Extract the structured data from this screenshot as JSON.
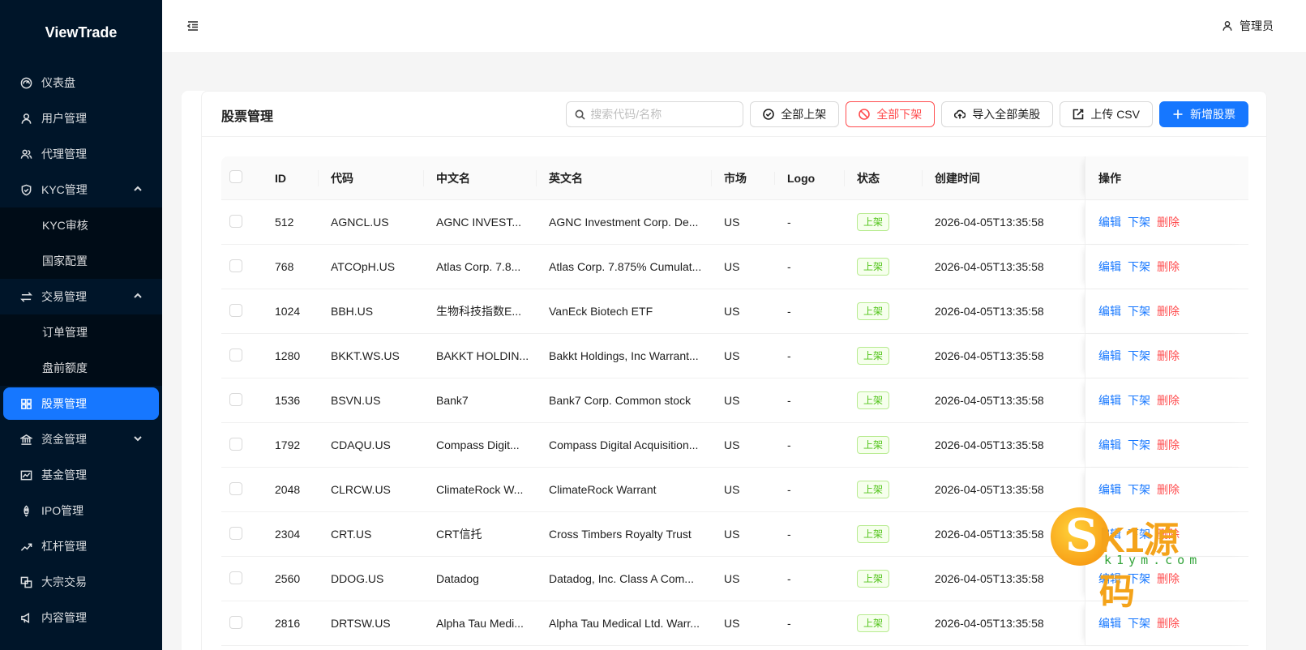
{
  "sidebar": {
    "logo": "ViewTrade",
    "items": [
      {
        "label": "仪表盘",
        "icon": "dashboard-icon"
      },
      {
        "label": "用户管理",
        "icon": "user-icon"
      },
      {
        "label": "代理管理",
        "icon": "team-icon"
      },
      {
        "label": "KYC管理",
        "icon": "shield-icon",
        "expanded": true,
        "children": [
          {
            "label": "KYC审核"
          },
          {
            "label": "国家配置"
          }
        ]
      },
      {
        "label": "交易管理",
        "icon": "swap-icon",
        "expanded": true,
        "children": [
          {
            "label": "订单管理"
          },
          {
            "label": "盘前额度"
          }
        ]
      },
      {
        "label": "股票管理",
        "icon": "grid-icon",
        "active": true
      },
      {
        "label": "资金管理",
        "icon": "bank-icon",
        "expanded": false
      },
      {
        "label": "基金管理",
        "icon": "fund-icon"
      },
      {
        "label": "IPO管理",
        "icon": "rocket-icon"
      },
      {
        "label": "杠杆管理",
        "icon": "rise-icon"
      },
      {
        "label": "大宗交易",
        "icon": "block-icon"
      },
      {
        "label": "内容管理",
        "icon": "sound-icon"
      }
    ]
  },
  "header": {
    "user": "管理员"
  },
  "card": {
    "title": "股票管理",
    "search_placeholder": "搜索代码/名称",
    "buttons": {
      "list_all": "全部上架",
      "delist_all": "全部下架",
      "import_us": "导入全部美股",
      "upload_csv": "上传 CSV",
      "add_stock": "新增股票"
    }
  },
  "table": {
    "columns": {
      "id": "ID",
      "code": "代码",
      "cn_name": "中文名",
      "en_name": "英文名",
      "market": "市场",
      "logo": "Logo",
      "status": "状态",
      "created": "创建时间",
      "actions": "操作"
    },
    "actions": {
      "edit": "编辑",
      "delist": "下架",
      "delete": "删除"
    },
    "rows": [
      {
        "id": "512",
        "code": "AGNCL.US",
        "cn": "AGNC INVEST...",
        "en": "AGNC Investment Corp. De...",
        "market": "US",
        "logo": "-",
        "status": "上架",
        "created": "2026-04-05T13:35:58"
      },
      {
        "id": "768",
        "code": "ATCOpH.US",
        "cn": "Atlas Corp. 7.8...",
        "en": "Atlas Corp. 7.875% Cumulat...",
        "market": "US",
        "logo": "-",
        "status": "上架",
        "created": "2026-04-05T13:35:58"
      },
      {
        "id": "1024",
        "code": "BBH.US",
        "cn": "生物科技指数E...",
        "en": "VanEck Biotech ETF",
        "market": "US",
        "logo": "-",
        "status": "上架",
        "created": "2026-04-05T13:35:58"
      },
      {
        "id": "1280",
        "code": "BKKT.WS.US",
        "cn": "BAKKT HOLDIN...",
        "en": "Bakkt Holdings, Inc Warrant...",
        "market": "US",
        "logo": "-",
        "status": "上架",
        "created": "2026-04-05T13:35:58"
      },
      {
        "id": "1536",
        "code": "BSVN.US",
        "cn": "Bank7",
        "en": "Bank7 Corp. Common stock",
        "market": "US",
        "logo": "-",
        "status": "上架",
        "created": "2026-04-05T13:35:58"
      },
      {
        "id": "1792",
        "code": "CDAQU.US",
        "cn": "Compass Digit...",
        "en": "Compass Digital Acquisition...",
        "market": "US",
        "logo": "-",
        "status": "上架",
        "created": "2026-04-05T13:35:58"
      },
      {
        "id": "2048",
        "code": "CLRCW.US",
        "cn": "ClimateRock W...",
        "en": "ClimateRock Warrant",
        "market": "US",
        "logo": "-",
        "status": "上架",
        "created": "2026-04-05T13:35:58"
      },
      {
        "id": "2304",
        "code": "CRT.US",
        "cn": "CRT信托",
        "en": "Cross Timbers Royalty Trust",
        "market": "US",
        "logo": "-",
        "status": "上架",
        "created": "2026-04-05T13:35:58"
      },
      {
        "id": "2560",
        "code": "DDOG.US",
        "cn": "Datadog",
        "en": "Datadog, Inc. Class A Com...",
        "market": "US",
        "logo": "-",
        "status": "上架",
        "created": "2026-04-05T13:35:58"
      },
      {
        "id": "2816",
        "code": "DRTSW.US",
        "cn": "Alpha Tau Medi...",
        "en": "Alpha Tau Medical Ltd. Warr...",
        "market": "US",
        "logo": "-",
        "status": "上架",
        "created": "2026-04-05T13:35:58"
      }
    ]
  },
  "watermark": {
    "brand": "K1源码",
    "url": "k1ym.com"
  }
}
